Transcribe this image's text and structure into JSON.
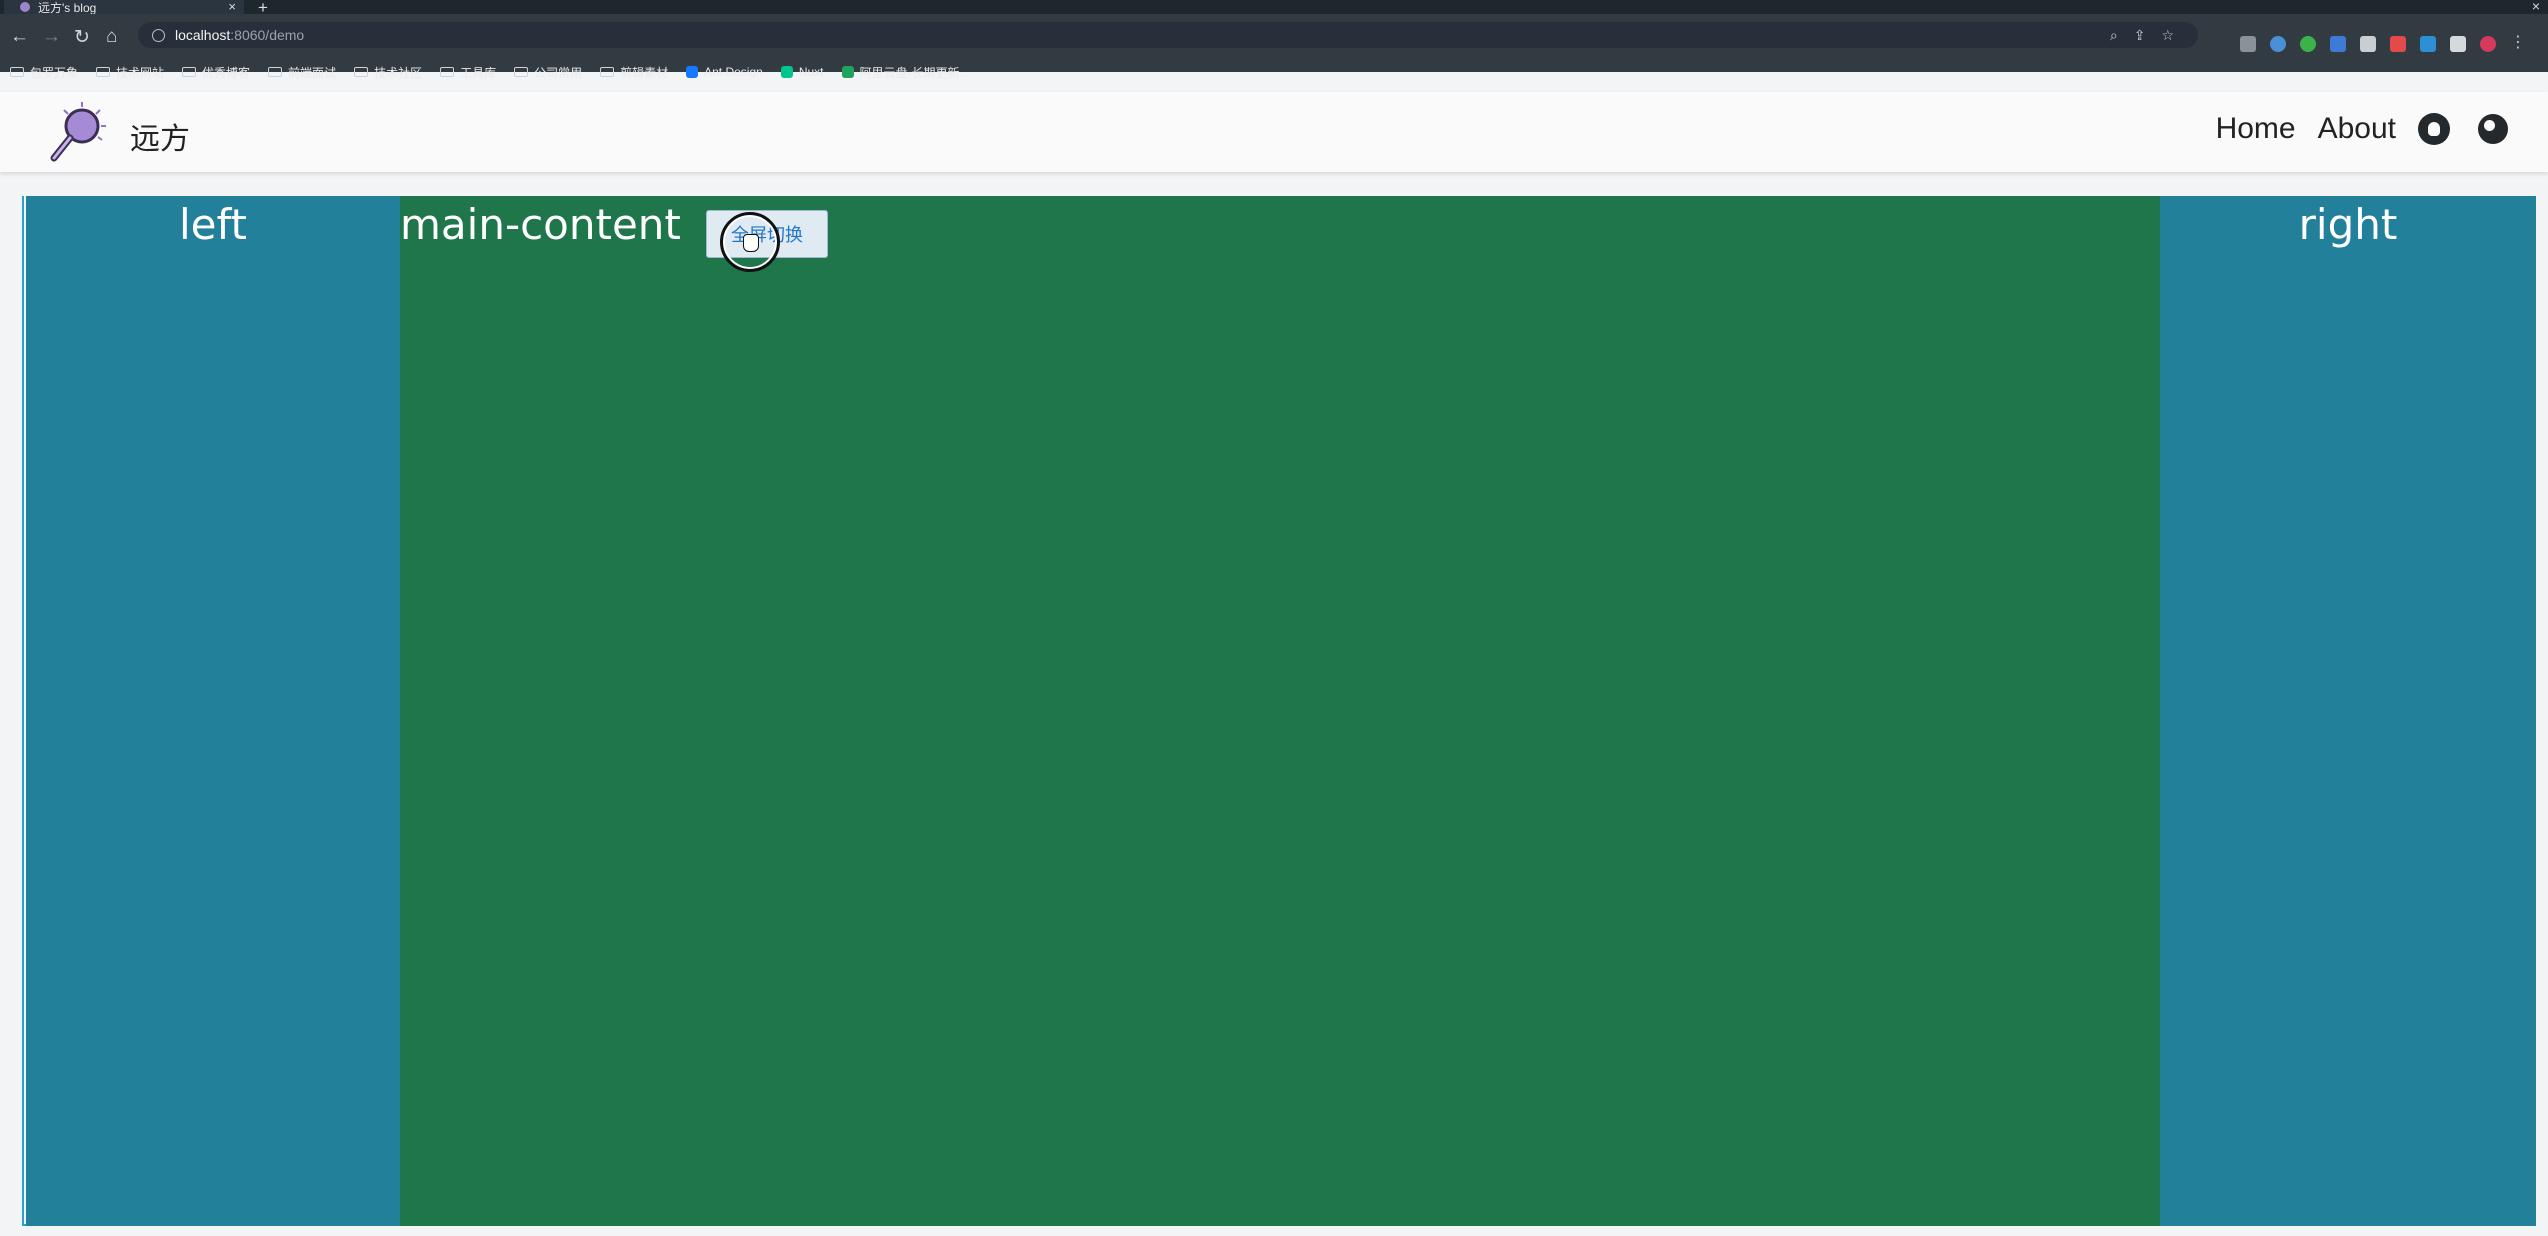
{
  "browser": {
    "tab_title": "远方's blog",
    "url_host": "localhost",
    "url_path": ":8060/demo",
    "bookmarks": [
      "包罗万象",
      "技术网站",
      "优秀博客",
      "前端面试",
      "技术社区",
      "工具库",
      "公司常用",
      "剪辑素材",
      "Ant Design",
      "Nuxt",
      "阿里云盘-长期更新..."
    ]
  },
  "site": {
    "brand": "远方",
    "nav": {
      "home": "Home",
      "about": "About"
    }
  },
  "layout": {
    "left_label": "left",
    "main_label": "main-content",
    "right_label": "right",
    "toggle_label": "全屏切换"
  },
  "colors": {
    "side_panel": "#23809b",
    "main_panel": "#1f764b",
    "border": "#2a9fd3"
  }
}
